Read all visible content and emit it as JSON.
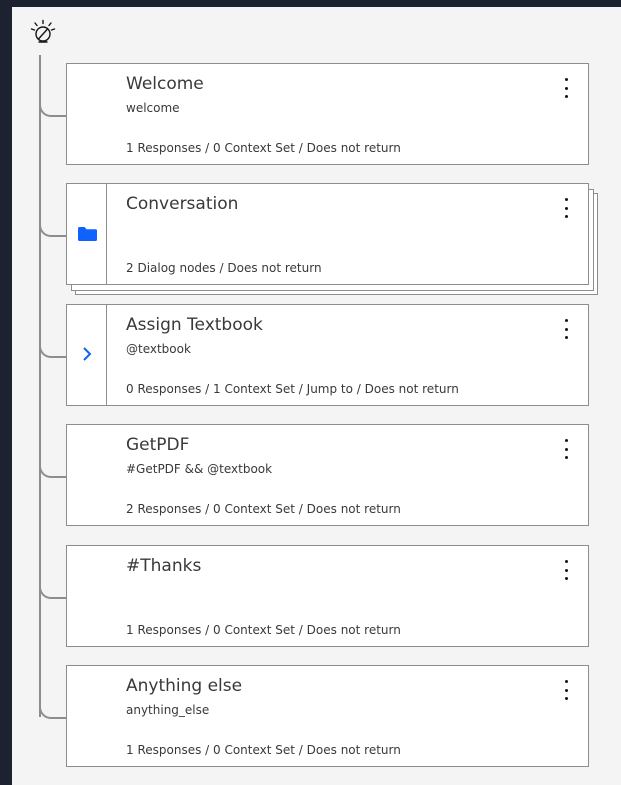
{
  "tree": {
    "root_icon": "watson-bulb-icon",
    "nodes": [
      {
        "title": "Welcome",
        "condition": "welcome",
        "meta": "1 Responses / 0 Context Set / Does not return",
        "gutter": "none"
      },
      {
        "title": "Conversation",
        "condition": "",
        "meta": "2 Dialog nodes / Does not return",
        "gutter": "folder-icon"
      },
      {
        "title": "Assign Textbook",
        "condition": "@textbook",
        "meta": "0 Responses / 1 Context Set / Jump to / Does not return",
        "gutter": "chevron-right-icon"
      },
      {
        "title": "GetPDF",
        "condition": "#GetPDF && @textbook",
        "meta": "2 Responses / 0 Context Set / Does not return",
        "gutter": "none"
      },
      {
        "title": "#Thanks",
        "condition": "",
        "meta": "1 Responses / 0 Context Set / Does not return",
        "gutter": "none"
      },
      {
        "title": "Anything else",
        "condition": "anything_else",
        "meta": "1 Responses / 0 Context Set / Does not return",
        "gutter": "none"
      }
    ]
  },
  "colors": {
    "outer_background": "#1d2230",
    "canvas": "#f4f4f4",
    "border": "#8d8d8d",
    "accent": "#0f62fe",
    "text": "#393939"
  }
}
